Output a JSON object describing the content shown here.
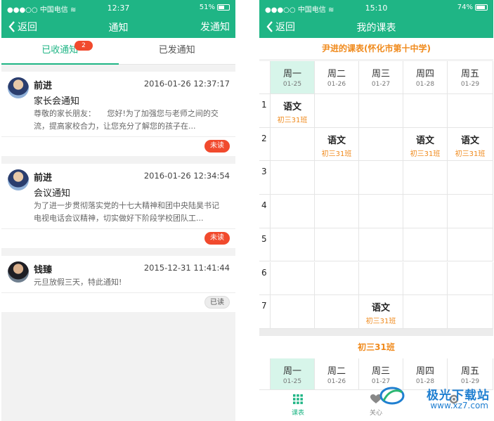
{
  "left": {
    "status": {
      "carrier": "中国电信",
      "time": "12:37",
      "battery": "51%"
    },
    "nav": {
      "back": "返回",
      "title": "通知",
      "action": "发通知"
    },
    "tabs": [
      {
        "label": "已收通知",
        "badge": "2"
      },
      {
        "label": "已发通知"
      }
    ],
    "notifications": [
      {
        "sender": "前进",
        "time": "2016-01-26 12:37:17",
        "subject": "家长会通知",
        "preview": "尊敬的家长朋友：　　您好!为了加强您与老师之间的交流，提高家校合力，让您充分了解您的孩子在...",
        "status": "未读"
      },
      {
        "sender": "前进",
        "time": "2016-01-26 12:34:54",
        "subject": "会议通知",
        "preview": "为了进一步贯彻落实党的十七大精神和团中央陆昊书记电视电话会议精神，切实做好下阶段学校团队工...",
        "status": "未读"
      },
      {
        "sender": "钱臻",
        "time": "2015-12-31 11:41:44",
        "subject": "",
        "preview": "元旦放假三天，特此通知!",
        "status": "已读"
      }
    ]
  },
  "right": {
    "status": {
      "carrier": "中国电信",
      "time": "15:10",
      "battery": "74%"
    },
    "nav": {
      "back": "返回",
      "title": "我的课表"
    },
    "schedule_title": "尹进的课表(怀化市第十中学)",
    "days": [
      {
        "day": "周一",
        "date": "01-25"
      },
      {
        "day": "周二",
        "date": "01-26"
      },
      {
        "day": "周三",
        "date": "01-27"
      },
      {
        "day": "周四",
        "date": "01-28"
      },
      {
        "day": "周五",
        "date": "01-29"
      }
    ],
    "periods": [
      "1",
      "2",
      "3",
      "4",
      "5",
      "6",
      "7"
    ],
    "lessons": [
      {
        "period": 1,
        "day": 0,
        "subject": "语文",
        "class": "初三31班"
      },
      {
        "period": 2,
        "day": 1,
        "subject": "语文",
        "class": "初三31班"
      },
      {
        "period": 2,
        "day": 3,
        "subject": "语文",
        "class": "初三31班"
      },
      {
        "period": 2,
        "day": 4,
        "subject": "语文",
        "class": "初三31班"
      },
      {
        "period": 7,
        "day": 2,
        "subject": "语文",
        "class": "初三31班"
      }
    ],
    "class_title": "初三31班",
    "tabbar": [
      {
        "label": "课表",
        "icon": "grid-icon"
      },
      {
        "label": "关心",
        "icon": "heart-icon"
      },
      {
        "label": "",
        "icon": "settings-icon"
      }
    ],
    "watermark": {
      "text": "极光下载站",
      "url": "www.xz7.com"
    }
  },
  "colors": {
    "primary": "#1fb585",
    "accent": "#f08a1c",
    "alert": "#f14a2d"
  }
}
